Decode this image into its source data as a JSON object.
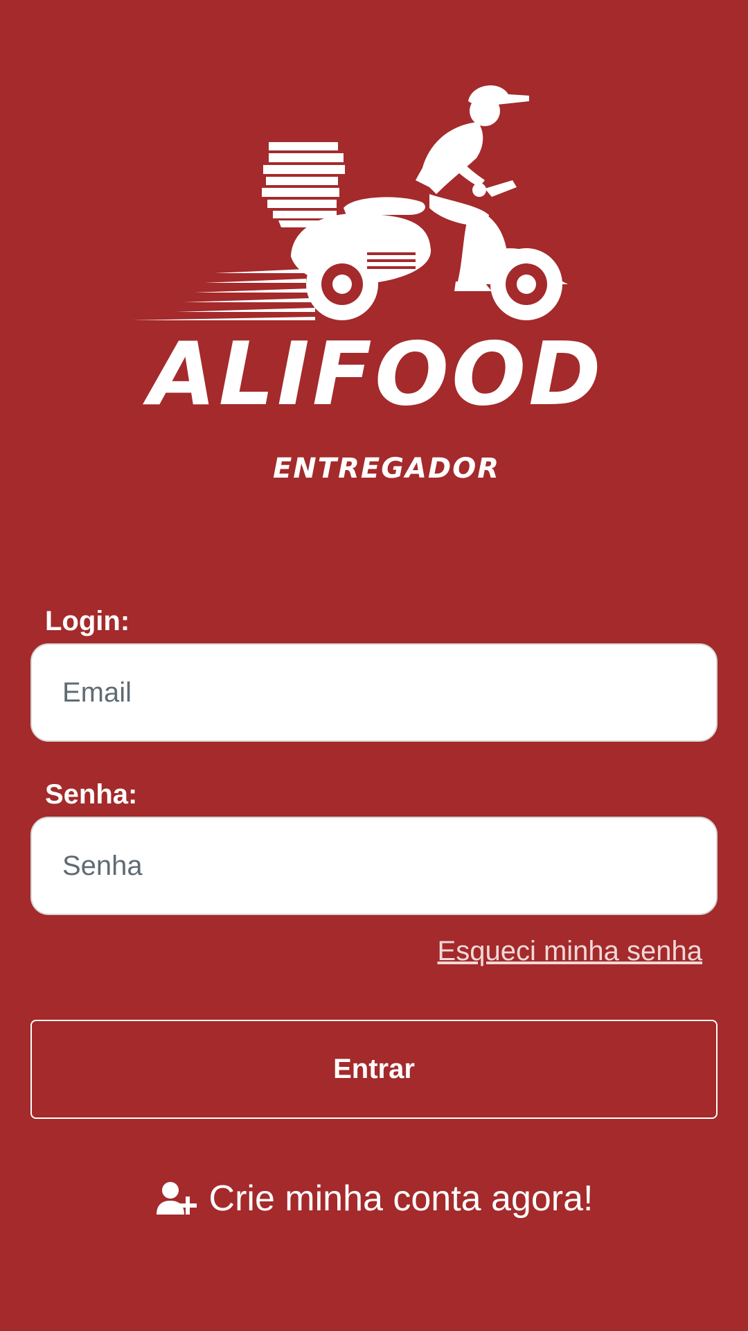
{
  "colors": {
    "background": "#a42a2b",
    "text": "#ffffff",
    "input_background": "#ffffff",
    "placeholder": "#5f6b72",
    "link": "#f1d8d8"
  },
  "logo": {
    "name": "ALIFOOD",
    "subtitle": "ENTREGADOR",
    "icon": "delivery-scooter-icon"
  },
  "form": {
    "login": {
      "label": "Login:",
      "placeholder": "Email",
      "value": ""
    },
    "password": {
      "label": "Senha:",
      "placeholder": "Senha",
      "value": ""
    },
    "forgot_password": "Esqueci minha senha",
    "submit_label": "Entrar"
  },
  "signup": {
    "icon": "user-plus-icon",
    "label": "Crie minha conta agora!"
  }
}
